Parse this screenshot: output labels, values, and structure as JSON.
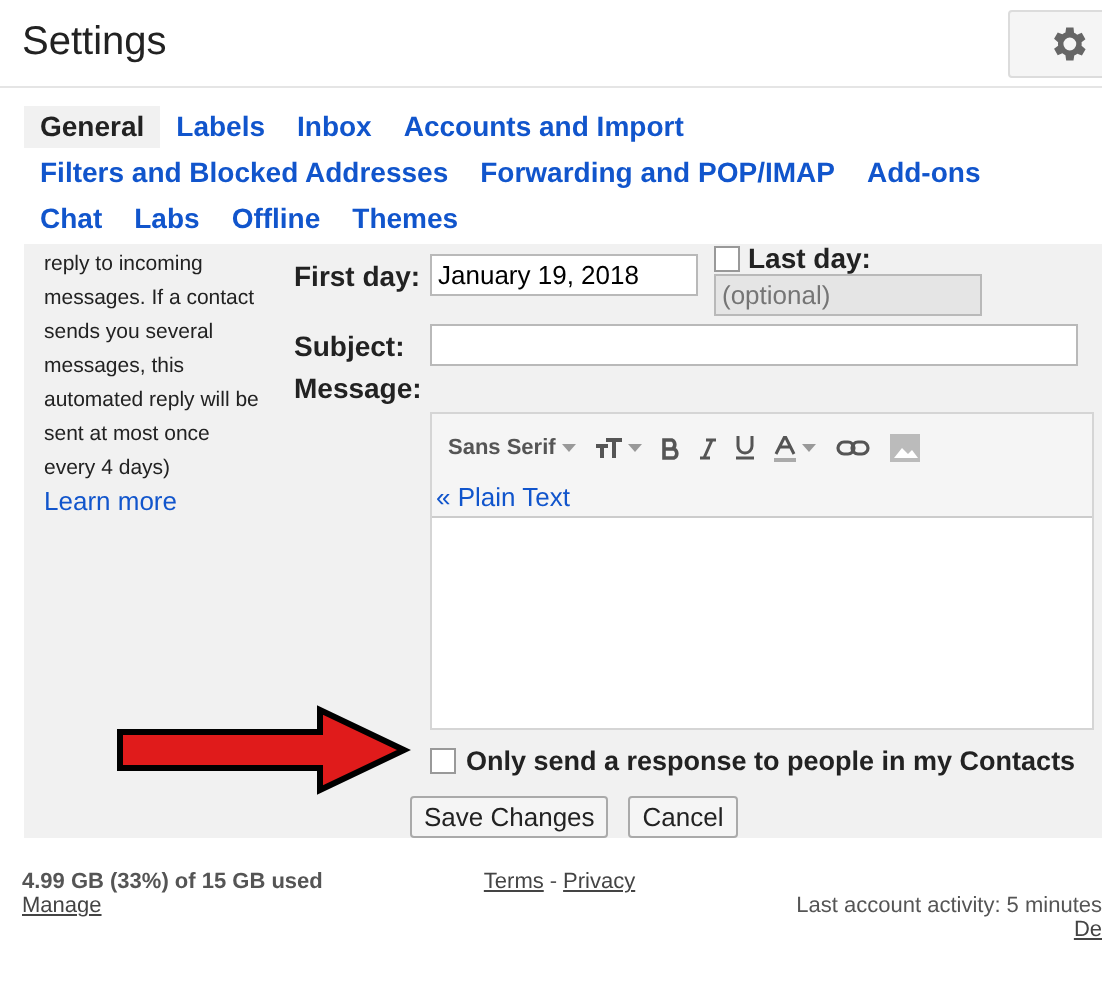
{
  "header": {
    "title": "Settings"
  },
  "tabs": [
    {
      "label": "General",
      "selected": true
    },
    {
      "label": "Labels",
      "selected": false
    },
    {
      "label": "Inbox",
      "selected": false
    },
    {
      "label": "Accounts and Import",
      "selected": false
    },
    {
      "label": "Filters and Blocked Addresses",
      "selected": false
    },
    {
      "label": "Forwarding and POP/IMAP",
      "selected": false
    },
    {
      "label": "Add-ons",
      "selected": false
    },
    {
      "label": "Chat",
      "selected": false
    },
    {
      "label": "Labs",
      "selected": false
    },
    {
      "label": "Offline",
      "selected": false
    },
    {
      "label": "Themes",
      "selected": false
    }
  ],
  "description": {
    "lines": [
      "reply to incoming",
      "messages. If a contact",
      "sends you several",
      "messages, this",
      "automated reply will be",
      "sent at most once",
      "every 4 days)"
    ],
    "link": "Learn more"
  },
  "form": {
    "first_day_label": "First day:",
    "first_day_value": "January 19, 2018",
    "last_day_label": "Last day:",
    "last_day_checked": false,
    "last_day_placeholder": "(optional)",
    "subject_label": "Subject:",
    "message_label": "Message:"
  },
  "toolbar": {
    "font": "Sans Serif",
    "plain_text_link": "« Plain Text"
  },
  "contacts_only": {
    "label": "Only send a response to people in my Contacts",
    "checked": false
  },
  "buttons": [
    "Save Changes",
    "Cancel"
  ],
  "footer": {
    "storage": "4.99 GB (33%) of 15 GB used",
    "manage": "Manage",
    "terms": "Terms",
    "separator": "-",
    "privacy": "Privacy",
    "activity": "Last account activity: 5 minutes",
    "details": "De"
  }
}
